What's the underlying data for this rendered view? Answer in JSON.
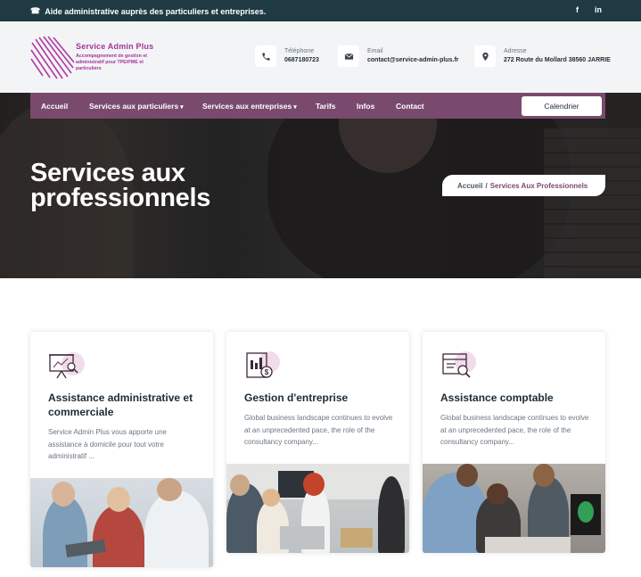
{
  "topbar": {
    "message": "Aide administrative auprès des particuliers et entreprises.",
    "social_facebook": "f",
    "social_linkedin": "in"
  },
  "logo": {
    "brand": "Service Admin Plus",
    "tagline": "Accompagnement de gestion et administratif pour TPE/PME et particuliers"
  },
  "contact": {
    "phone_label": "Téléphone",
    "phone_value": "0687180723",
    "email_label": "Email",
    "email_value": "contact@service-admin-plus.fr",
    "address_label": "Adresse",
    "address_value": "272 Route du Mollard 38560 JARRIE"
  },
  "nav": {
    "items": [
      "Accueil",
      "Services aux particuliers",
      "Services aux entreprises",
      "Tarifs",
      "Infos",
      "Contact"
    ],
    "cta": "Calendrier"
  },
  "hero": {
    "title": "Services aux professionnels",
    "breadcrumb_home": "Accueil",
    "breadcrumb_sep": "/",
    "breadcrumb_current": "Services Aux Professionnels"
  },
  "cards": [
    {
      "title": "Assistance administrative et commerciale",
      "description": "Service Admin Plus vous apporte une assistance à domicile pour tout votre administratif ...",
      "icon": "presentation-chart-icon"
    },
    {
      "title": "Gestion d'entreprise",
      "description": "Global business landscape continues to evolve at an unprecedented pace, the role of the consultancy company...",
      "icon": "finance-report-icon"
    },
    {
      "title": "Assistance comptable",
      "description": "Global business landscape continues to evolve at an unprecedented pace, the role of the consultancy company...",
      "icon": "accounting-search-icon"
    }
  ],
  "colors": {
    "topbar": "#1f3a42",
    "nav": "#7a4a6e",
    "brand": "#a4359b",
    "icon_accent": "#f2dceb"
  }
}
